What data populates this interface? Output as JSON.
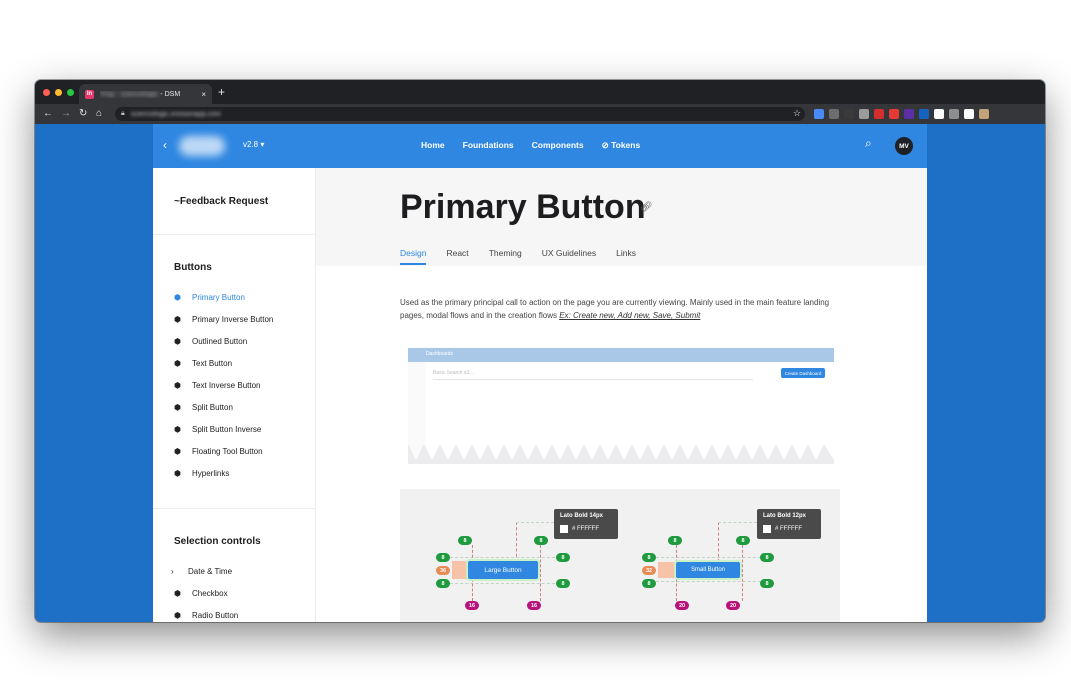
{
  "browser": {
    "tab_favicon": "In",
    "tab_title_blur": "Ping - sciencelogic",
    "tab_title_suffix": " - DSM",
    "tab_close": "×",
    "new_tab": "+",
    "url": "sciencelogic.invisionapp.com",
    "extension_colors": [
      "#4a8af4",
      "#6d6d6d",
      "#3a3a3a",
      "#9b9b9b",
      "#d32f2f",
      "#e53935",
      "#5b2fa6",
      "#1565c0",
      "#ffffff",
      "#8e8e8e",
      "#ffffff",
      "#c3a37a"
    ]
  },
  "header": {
    "version": "v2.8 ▾",
    "nav": [
      "Home",
      "Foundations",
      "Components",
      "Tokens"
    ],
    "avatar": "MV"
  },
  "sidebar": {
    "feedback": "~Feedback Request",
    "buttons_title": "Buttons",
    "buttons": [
      {
        "label": "Primary Button",
        "active": true
      },
      {
        "label": "Primary Inverse Button"
      },
      {
        "label": "Outlined Button"
      },
      {
        "label": "Text Button"
      },
      {
        "label": "Text Inverse Button"
      },
      {
        "label": "Split Button"
      },
      {
        "label": "Split Button Inverse"
      },
      {
        "label": "Floating Tool Button"
      },
      {
        "label": "Hyperlinks"
      }
    ],
    "selection_title": "Selection controls",
    "selection": [
      {
        "label": "Date & Time"
      },
      {
        "label": "Checkbox"
      },
      {
        "label": "Radio Button"
      }
    ]
  },
  "main": {
    "title": "Primary Button",
    "tabs": [
      "Design",
      "React",
      "Theming",
      "UX Guidelines",
      "Links"
    ],
    "description": "Used as the primary principal call to action on the page you are currently viewing. Mainly used in the main feature landing pages, modal flows and in the creation flows",
    "description_example": "Ex: Create new, Add new, Save, Submit",
    "example": {
      "bar_title": "Dashboards",
      "search_placeholder": "Basic Search a3…",
      "create_button": "Create Dashboard"
    },
    "spec": {
      "large_tip_title": "Lato Bold 14px",
      "small_tip_title": "Lato Bold 12px",
      "tip_color": "# FFFFFF",
      "large_button": "Large Button",
      "small_button": "Small Button",
      "large_height": "36",
      "small_height": "32",
      "large_padding": "16",
      "small_padding": "20",
      "spacing": "8"
    }
  },
  "colors": {
    "chrome_bg": "#202124",
    "page_blue": "#1e6fc6",
    "header_blue": "#2f87e1",
    "spec_green": "#1f9a3e",
    "spec_orange": "#e98b55",
    "spec_magenta": "#b8137a"
  }
}
